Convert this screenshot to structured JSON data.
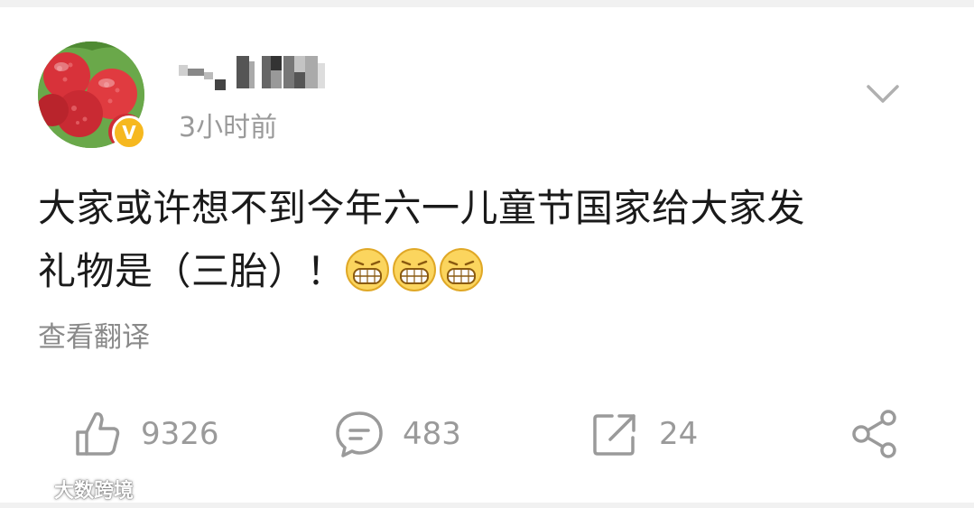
{
  "post": {
    "author": {
      "name_obscured": true,
      "verified_badge": "V",
      "avatar": "lychee-avatar"
    },
    "timestamp": "3小时前",
    "text_line1": "大家或许想不到今年六一儿童节国家给大家发",
    "text_line2": "礼物是（三胎）！",
    "emojis": [
      "grin-emoji",
      "grin-emoji",
      "grin-emoji"
    ],
    "translate_label": "查看翻译"
  },
  "actions": {
    "likes": "9326",
    "comments": "483",
    "reposts": "24"
  },
  "icons": {
    "more": "chevron-down-icon",
    "like": "thumbs-up-icon",
    "comment": "comment-icon",
    "repost": "repost-icon",
    "share": "share-icon"
  },
  "watermark": {
    "text": "大数跨境"
  },
  "colors": {
    "badge": "#f6b81f",
    "muted_text": "#9a9a9a",
    "icon_gray": "#9a9a9a",
    "body_text": "#1a1a1a"
  }
}
